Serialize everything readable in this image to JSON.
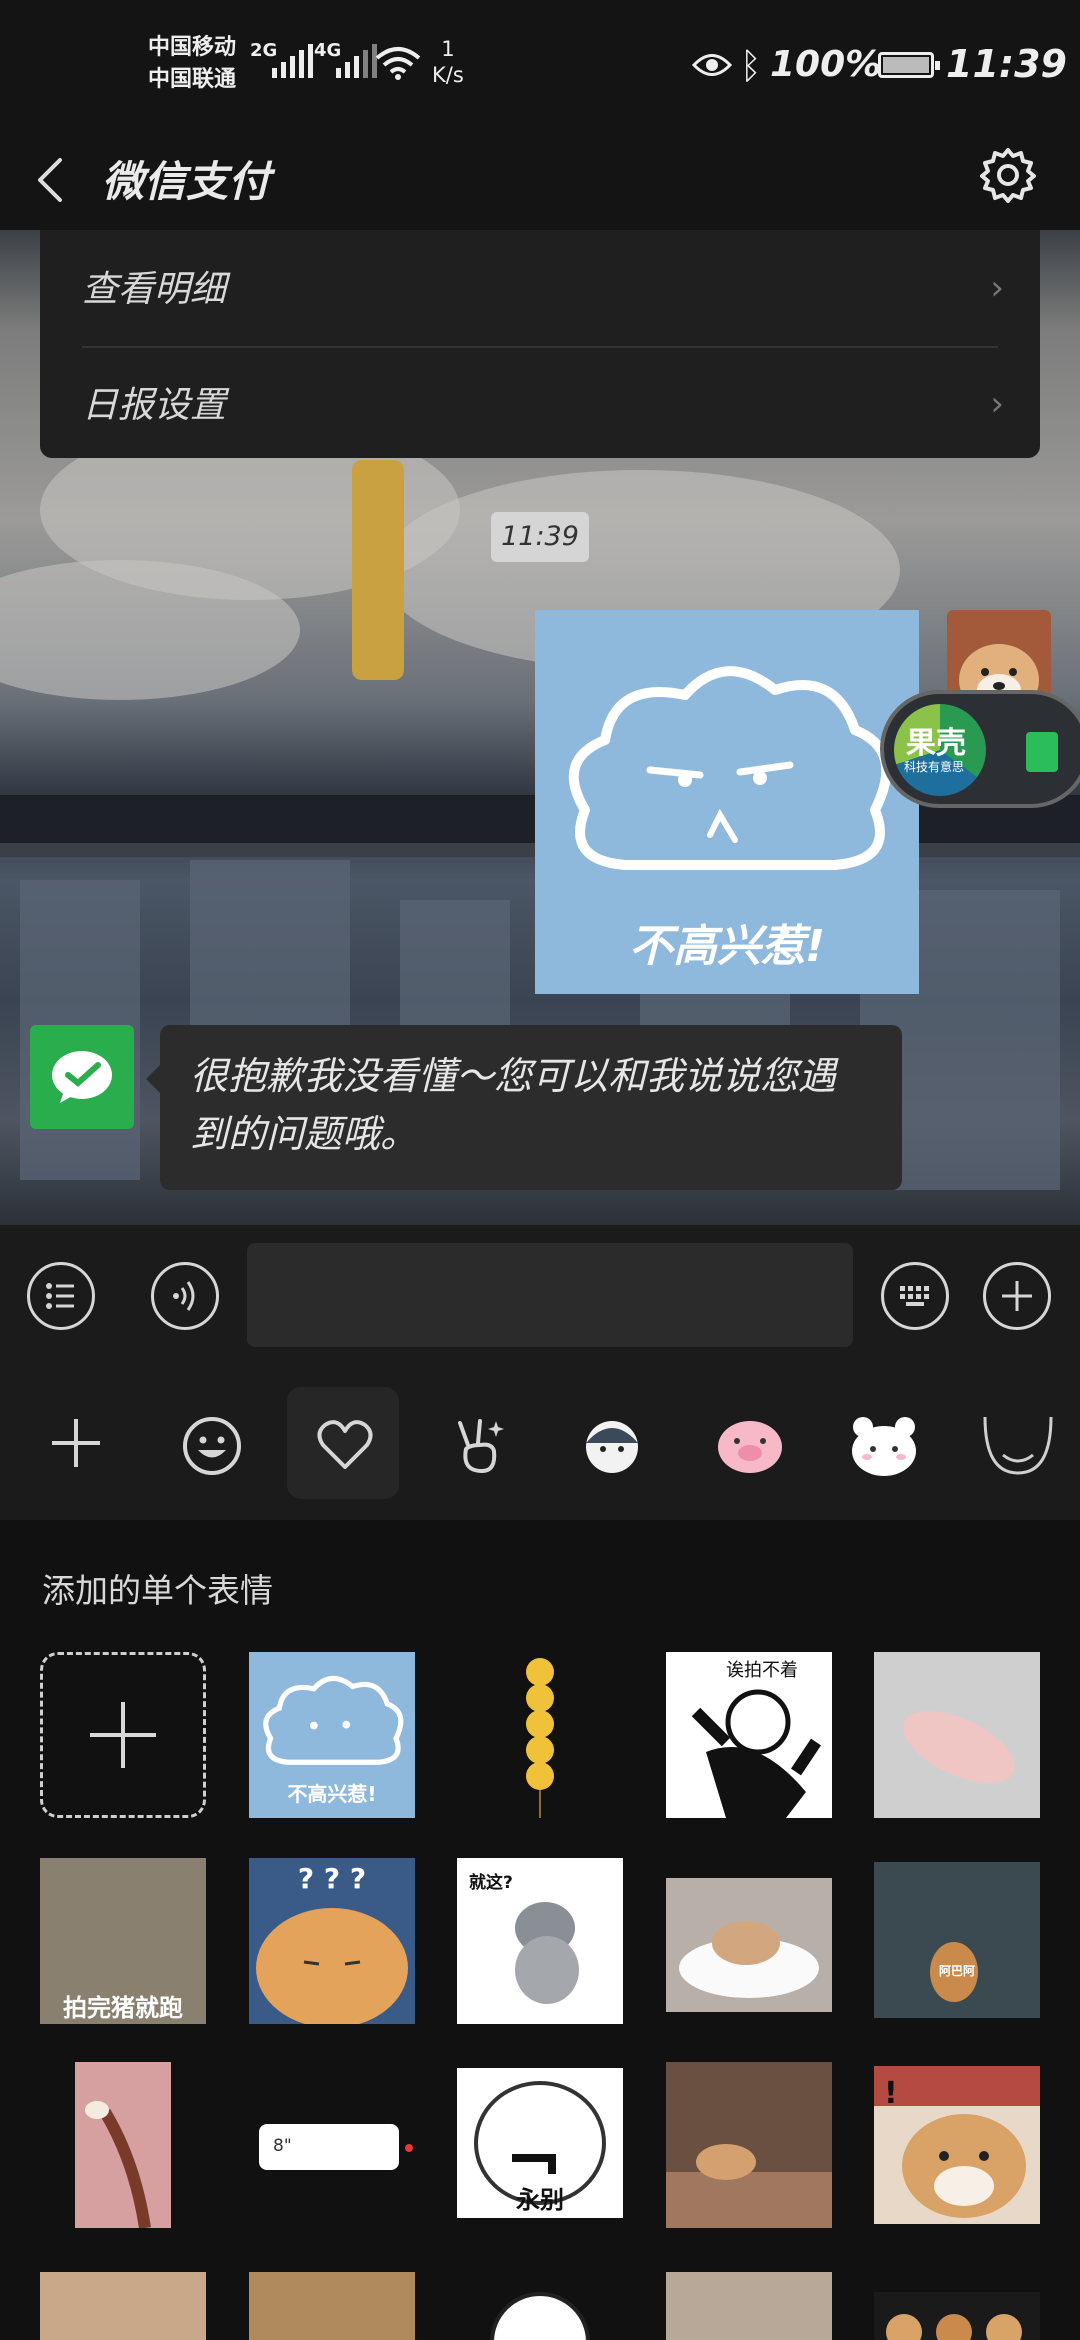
{
  "status_bar": {
    "carrier_1": "中国移动",
    "carrier_2": "中国联通",
    "signal_1": "2G",
    "signal_2": "4G",
    "speed_value": "1",
    "speed_unit": "K/s",
    "battery": "100%",
    "time": "11:39"
  },
  "header": {
    "title": "微信支付"
  },
  "menu": {
    "items": [
      {
        "label": "查看明细"
      },
      {
        "label": "日报设置"
      }
    ]
  },
  "chat": {
    "timestamp": "11:39",
    "sticker_caption": "不高兴惹!",
    "widget_brand": "果壳",
    "widget_sub": "科技有意思",
    "bot_message": "很抱歉我没看懂～您可以和我说说您遇到的问题哦。"
  },
  "input": {
    "placeholder": ""
  },
  "sticker_panel": {
    "section_title": "添加的单个表情",
    "captions": {
      "sticker_4": "诶拍不着",
      "sticker_6": "拍完猪就跑",
      "sticker_7": "? ? ?",
      "sticker_8": "就这?",
      "sticker_10": "阿巴阿",
      "sticker_12": "8\"",
      "sticker_13": "永别",
      "sticker_15": "!"
    }
  },
  "colors": {
    "wechat_green": "#2aae4d",
    "sticker_blue": "#8fb8dd",
    "panel_bg": "#111111"
  }
}
